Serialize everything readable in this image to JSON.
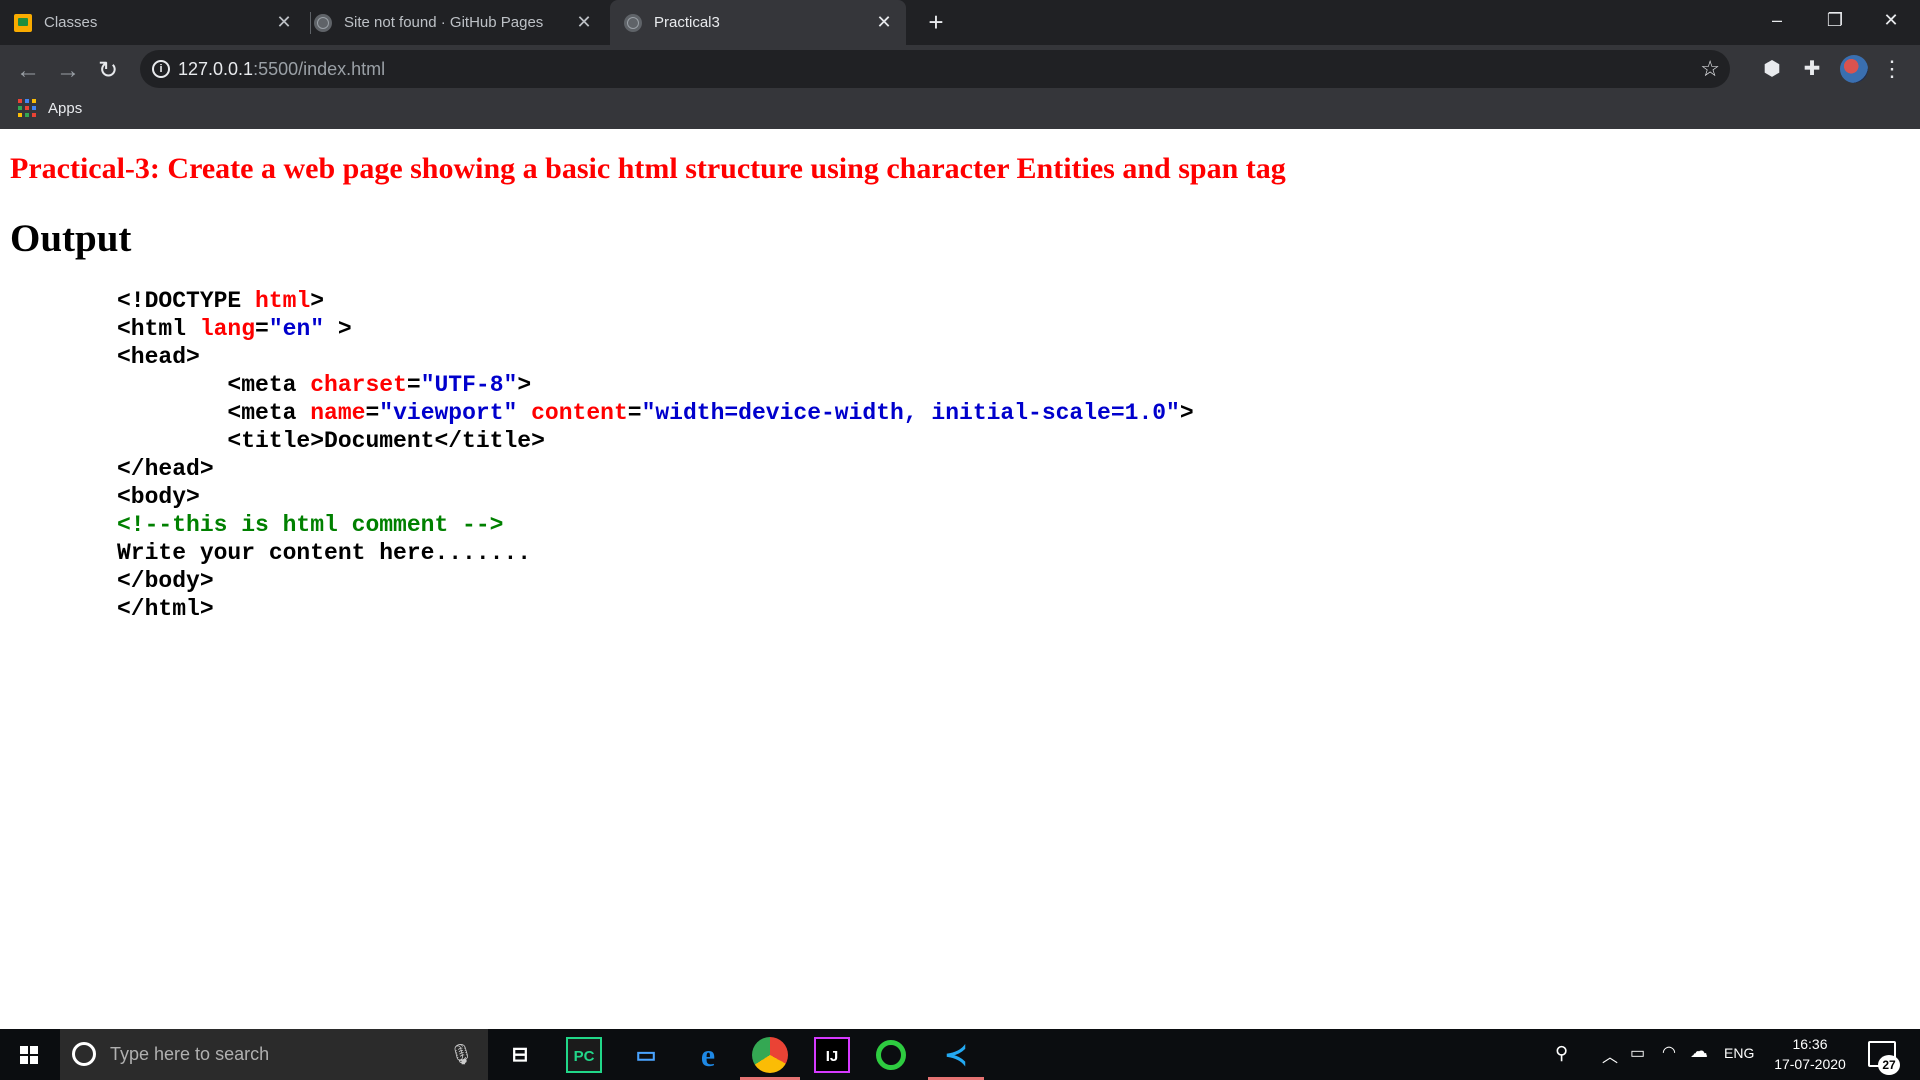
{
  "browser": {
    "tabs": [
      {
        "title": "Classes",
        "active": false
      },
      {
        "title": "Site not found · GitHub Pages",
        "active": false
      },
      {
        "title": "Practical3",
        "active": true
      }
    ],
    "new_tab_label": "+",
    "address": {
      "host": "127.0.0.1",
      "path": ":5500/index.html"
    },
    "bookmarks": [
      {
        "label": "Apps"
      }
    ],
    "window_controls": {
      "minimize": "–",
      "restore": "❐",
      "close": "✕"
    }
  },
  "page": {
    "heading": "Practical-3: Create a web page showing a basic html structure using character Entities and span tag",
    "output_title": "Output",
    "code_lines": [
      {
        "indent": "",
        "parts": [
          {
            "t": "<!DOCTYPE ",
            "c": "tag"
          },
          {
            "t": "html",
            "c": "attr"
          },
          {
            "t": ">",
            "c": "tag"
          }
        ]
      },
      {
        "indent": "",
        "parts": [
          {
            "t": "<html ",
            "c": "tag"
          },
          {
            "t": "lang",
            "c": "attr"
          },
          {
            "t": "=",
            "c": "tag"
          },
          {
            "t": "\"en\"",
            "c": "val"
          },
          {
            "t": " >",
            "c": "tag"
          }
        ]
      },
      {
        "indent": "",
        "parts": [
          {
            "t": "<head>",
            "c": "tag"
          }
        ]
      },
      {
        "indent": "        ",
        "parts": [
          {
            "t": "<meta ",
            "c": "tag"
          },
          {
            "t": "charset",
            "c": "attr"
          },
          {
            "t": "=",
            "c": "tag"
          },
          {
            "t": "\"UTF-8\"",
            "c": "val"
          },
          {
            "t": ">",
            "c": "tag"
          }
        ]
      },
      {
        "indent": "        ",
        "parts": [
          {
            "t": "<meta ",
            "c": "tag"
          },
          {
            "t": "name",
            "c": "attr"
          },
          {
            "t": "=",
            "c": "tag"
          },
          {
            "t": "\"viewport\"",
            "c": "val"
          },
          {
            "t": " ",
            "c": "tag"
          },
          {
            "t": "content",
            "c": "attr"
          },
          {
            "t": "=",
            "c": "tag"
          },
          {
            "t": "\"width=device-width, initial-scale=1.0\"",
            "c": "val"
          },
          {
            "t": ">",
            "c": "tag"
          }
        ]
      },
      {
        "indent": "        ",
        "parts": [
          {
            "t": "<title>Document</title>",
            "c": "tag"
          }
        ]
      },
      {
        "indent": "",
        "parts": [
          {
            "t": "</head>",
            "c": "tag"
          }
        ]
      },
      {
        "indent": "",
        "parts": [
          {
            "t": "<body>",
            "c": "tag"
          }
        ]
      },
      {
        "indent": "",
        "parts": [
          {
            "t": "<!--this is html comment -->",
            "c": "cmt"
          }
        ]
      },
      {
        "indent": "",
        "parts": [
          {
            "t": "Write your content here.......",
            "c": "tag"
          }
        ]
      },
      {
        "indent": "",
        "parts": [
          {
            "t": "</body>",
            "c": "tag"
          }
        ]
      },
      {
        "indent": "",
        "parts": [
          {
            "t": "</html>",
            "c": "tag"
          }
        ]
      }
    ]
  },
  "taskbar": {
    "search_placeholder": "Type here to search",
    "language": "ENG",
    "time": "16:36",
    "date": "17-07-2020",
    "notification_count": "27",
    "pinned_icons": [
      "task-view-icon",
      "pycharm-icon",
      "file-explorer-icon",
      "edge-icon",
      "chrome-icon",
      "intellij-icon",
      "app-circle-icon",
      "vscode-icon"
    ]
  },
  "colors": {
    "heading": "#ff0000",
    "attr": "#ff0000",
    "value": "#0000cc",
    "comment": "#008000",
    "chrome_dark": "#202124",
    "chrome_toolbar": "#35363a",
    "taskbar": "#0b0d10"
  }
}
